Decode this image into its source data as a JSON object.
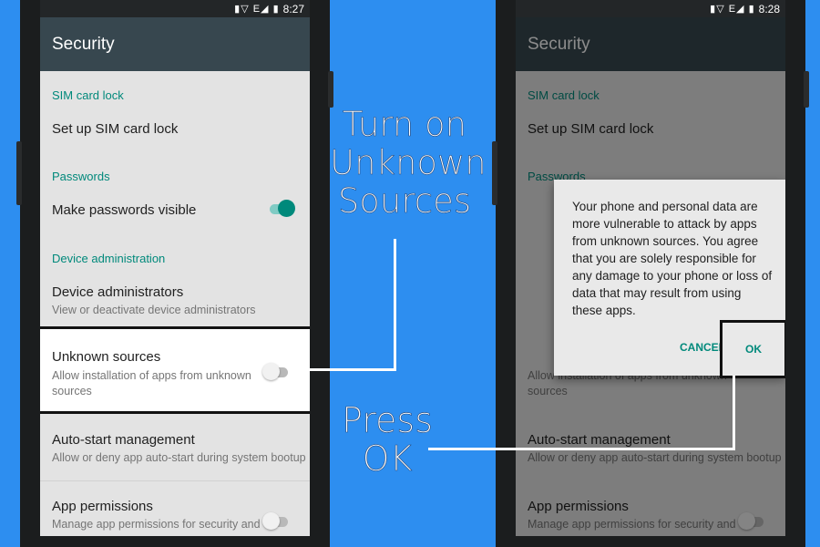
{
  "captions": {
    "turn_on": [
      "Turn on",
      "Unknown",
      "Sources"
    ],
    "press_ok": [
      "Press",
      "OK"
    ]
  },
  "left_phone": {
    "status": {
      "icons": "▮▽ E◢ ▮",
      "time": "8:27"
    },
    "appbar_title": "Security",
    "settings": {
      "sim_section": "SIM card lock",
      "sim_item": "Set up SIM card lock",
      "passwords_section": "Passwords",
      "passwords_item": "Make passwords visible",
      "device_admin_section": "Device administration",
      "device_admins_title": "Device administrators",
      "device_admins_sub": "View or deactivate device administrators",
      "unknown_title": "Unknown sources",
      "unknown_sub": "Allow installation of apps from unknown sources",
      "autostart_title": "Auto-start management",
      "autostart_sub": "Allow or deny app auto-start during system bootup",
      "app_perm_title": "App permissions",
      "app_perm_sub": "Manage app permissions for security and"
    },
    "toggles": {
      "passwords_visible": true,
      "unknown_sources": false,
      "app_permissions": false
    }
  },
  "right_phone": {
    "status": {
      "icons": "▮▽ E◢ ▮",
      "time": "8:28"
    },
    "appbar_title": "Security",
    "settings": {
      "sim_section": "SIM card lock",
      "sim_item": "Set up SIM card lock",
      "passwords_section": "Passwords",
      "unknown_sub_visible": "Allow installation of apps from unknown sources",
      "autostart_title": "Auto-start management",
      "autostart_sub": "Allow or deny app auto-start during system bootup",
      "app_perm_title": "App permissions",
      "app_perm_sub": "Manage app permissions for security and"
    },
    "dialog": {
      "message": "Your phone and personal data are more vulnerable to attack by apps from unknown sources. You agree that you are solely responsible for any damage to your phone or loss of data that may result from using these apps.",
      "cancel_label": "CANCEL",
      "ok_label": "OK"
    }
  },
  "colors": {
    "background": "#2d8ef0",
    "accent": "#00897b",
    "appbar": "#37474f"
  }
}
